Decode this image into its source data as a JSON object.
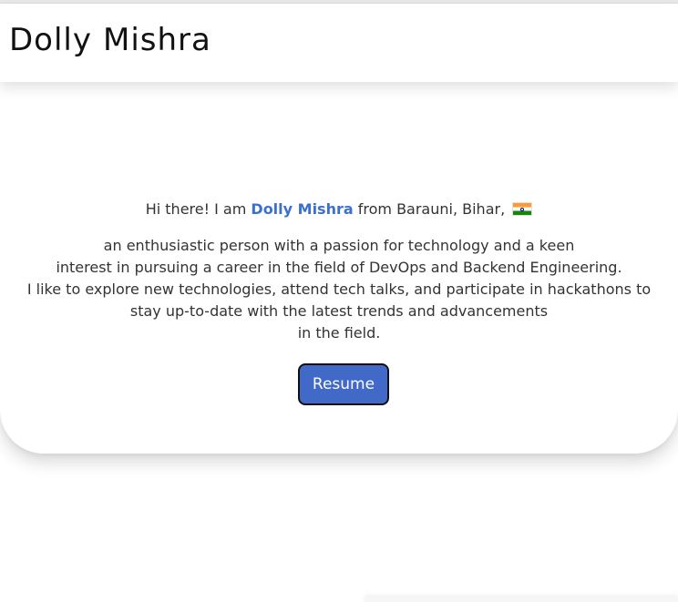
{
  "header": {
    "brand_first": "Dolly",
    "brand_last": "Mishra"
  },
  "hero": {
    "greeting": "Hi there! I am",
    "name": "Dolly Mishra",
    "location": "from Barauni, Bihar,",
    "flag_icon": "india-flag-icon",
    "bio_lines": [
      "an enthusiastic person with a passion for technology and a keen",
      "interest in pursuing a career in the field of DevOps and Backend Engineering.",
      "I like to explore new technologies, attend tech talks, and participate in hackathons to",
      "stay up-to-date with the latest trends and advancements",
      "in the field."
    ],
    "resume_label": "Resume"
  },
  "colors": {
    "accent": "#3b6fd1",
    "button_bg": "#4169c8",
    "text": "#333333"
  }
}
